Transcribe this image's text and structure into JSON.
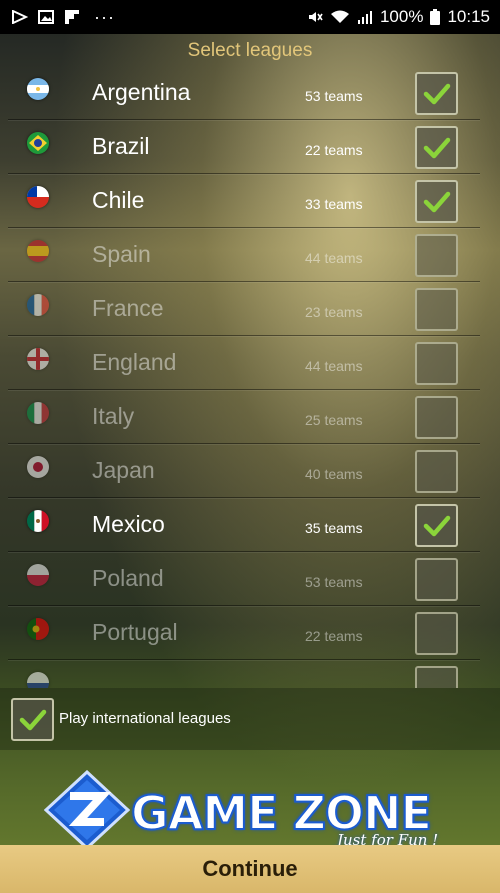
{
  "status_bar": {
    "battery": "100%",
    "time": "10:15",
    "more": "···",
    "left_icons": [
      "play-icon",
      "image-icon",
      "flipboard-icon"
    ],
    "right_icons": [
      "mute-icon",
      "wifi-icon",
      "signal-icon",
      "battery-icon"
    ]
  },
  "header": {
    "title": "Select leagues"
  },
  "leagues": [
    {
      "name": "Argentina",
      "teams": "53 teams",
      "checked": true,
      "flag": "argentina-flag-icon"
    },
    {
      "name": "Brazil",
      "teams": "22 teams",
      "checked": true,
      "flag": "brazil-flag-icon"
    },
    {
      "name": "Chile",
      "teams": "33 teams",
      "checked": true,
      "flag": "chile-flag-icon"
    },
    {
      "name": "Spain",
      "teams": "44 teams",
      "checked": false,
      "flag": "spain-flag-icon"
    },
    {
      "name": "France",
      "teams": "23 teams",
      "checked": false,
      "flag": "france-flag-icon"
    },
    {
      "name": "England",
      "teams": "44 teams",
      "checked": false,
      "flag": "england-flag-icon"
    },
    {
      "name": "Italy",
      "teams": "25 teams",
      "checked": false,
      "flag": "italy-flag-icon"
    },
    {
      "name": "Japan",
      "teams": "40 teams",
      "checked": false,
      "flag": "japan-flag-icon"
    },
    {
      "name": "Mexico",
      "teams": "35 teams",
      "checked": true,
      "flag": "mexico-flag-icon"
    },
    {
      "name": "Poland",
      "teams": "53 teams",
      "checked": false,
      "flag": "poland-flag-icon"
    },
    {
      "name": "Portugal",
      "teams": "22 teams",
      "checked": false,
      "flag": "portugal-flag-icon"
    },
    {
      "name": "",
      "teams": "",
      "checked": false,
      "flag": "partial-flag-icon"
    }
  ],
  "international": {
    "label": "Play international leagues",
    "checked": true
  },
  "brand": {
    "name": "GAME ZONE",
    "tagline": "Just for Fun !",
    "logo_icon": "z-logo-icon"
  },
  "footer": {
    "continue_label": "Continue"
  },
  "colors": {
    "title": "#e2c67a",
    "check": "#8bd43a",
    "continue_bg": "#ddbb70",
    "brand_blue": "#1b5ccf"
  }
}
